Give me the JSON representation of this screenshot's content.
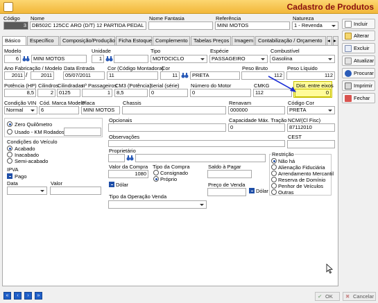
{
  "window": {
    "title": "Cadastro de Produtos"
  },
  "header": {
    "codigo_label": "Código",
    "codigo_value": "3",
    "nome_label": "Nome",
    "nome_value": "DB502C 125CC ARO (D/T) 12 PARTIDA PEDAL",
    "fantasia_label": "Nome Fantasia",
    "fantasia_value": "",
    "referencia_label": "Referência",
    "referencia_value": "MINI MOTOS",
    "natureza_label": "Natureza",
    "natureza_value": "1 - Revenda"
  },
  "tabs": [
    {
      "label": "Básico",
      "active": true
    },
    {
      "label": "Específico"
    },
    {
      "label": "Composição/Produção"
    },
    {
      "label": "Ficha Estoque"
    },
    {
      "label": "Complemento"
    },
    {
      "label": "Tabelas Preços"
    },
    {
      "label": "Imagem"
    },
    {
      "label": "Contabilização / Orçamento"
    }
  ],
  "sidebar": {
    "incluir": "Incluir",
    "alterar": "Alterar",
    "excluir": "Excluir",
    "atualizar": "Atualizar",
    "procurar": "Procurar",
    "imprimir": "Imprimir",
    "fechar": "Fechar"
  },
  "form": {
    "modelo_label": "Modelo",
    "modelo_code": "6",
    "modelo_name": "MINI MOTOS",
    "unidade_label": "Unidade",
    "unidade_value": "1",
    "tipo_label": "Tipo",
    "tipo_value": "MOTOCICLO",
    "especie_label": "Espécie",
    "especie_value": "PASSAGEIRO",
    "combustivel_label": "Combustível",
    "combustivel_value": "Gasolina",
    "ano_label": "Ano Fabricação / Modelo",
    "ano_fab": "2011",
    "ano_mod": "2011",
    "data_entrada_label": "Data Entrada",
    "data_entrada_value": "05/07/2011",
    "cor_montadora_label": "Cor (Código Montadora)",
    "cor_montadora_value": "11",
    "cor_label": "Cor",
    "cor_code": "11",
    "cor_name": "PRETA",
    "peso_bruto_label": "Peso Bruto",
    "peso_bruto_value": "112",
    "peso_liquido_label": "Peso Líquido",
    "peso_liquido_value": "112",
    "potencia_label": "Potência (HP)",
    "potencia_value": "8,5",
    "cilindros_label": "Cilindros",
    "cilindros_value": "2",
    "cilindradas_label": "Cilindradas",
    "cilindradas_value": "0125",
    "passageiros_label": "nº Passageiros",
    "passageiros_value": "1",
    "cm3_label": "CM3 (Potência)",
    "cm3_value": "8,5",
    "serial_label": "Serial (série)",
    "serial_value": "0",
    "motor_label": "Número do Motor",
    "motor_value": "0",
    "cmkg_label": "CMKG",
    "cmkg_value": "112",
    "dist_eixos_label": "Dist. entre eixos",
    "dist_eixos_value": "0",
    "condicao_vin_label": "Condição VIN",
    "condicao_vin_value": "Normal",
    "cod_marca_label": "Cód. Marca Modelo",
    "cod_marca_value": "6",
    "placa_label": "Placa",
    "placa_value": "MINI MOTOS",
    "chassis_label": "Chassis",
    "chassis_value": "",
    "renavam_label": "Renavam",
    "renavam_value": "000000",
    "codigo_cor_label": "Código Cor",
    "codigo_cor_value": "PRETA",
    "zero_km": "Zero Quilômetro",
    "usado_km": "Usado - KM Rodados",
    "opcionais_label": "Opcionais",
    "cap_tracao_label": "Capacidade Máx. Tração",
    "cap_tracao_value": "0",
    "ncm_label": "NCM/(Cl Fisc)",
    "ncm_value": "87112010",
    "observacoes_label": "Observações",
    "cest_label": "CEST",
    "condicoes_label": "Condições do Veículo",
    "acabado": "Acabado",
    "inacabado": "Inacabado",
    "semi_acabado": "Semi-acabado",
    "proprietario_label": "Proprietário",
    "ipva_label": "IPVA",
    "pago": "Pago",
    "data_label": "Data",
    "valor_label": "Valor",
    "valor_compra_label": "Valor da Compra",
    "valor_compra_value": "1080",
    "tipo_compra_label": "Tipo da Compra",
    "consignado": "Consignado",
    "proprio": "Próprio",
    "saldo_label": "Saldo à Pagar",
    "dolar": "Dólar",
    "preco_venda_label": "Preço de Venda",
    "tipo_venda_label": "Tipo da Operação Venda",
    "restricao_label": "Restrição",
    "restricoes": [
      "Não há",
      "Alienação Fiduciária",
      "Arrendamento Mercantil",
      "Reserva de Domínio",
      "Penhor de Veículos",
      "Outras"
    ]
  },
  "bottom": {
    "ok": "OK",
    "cancelar": "Cancelar"
  }
}
